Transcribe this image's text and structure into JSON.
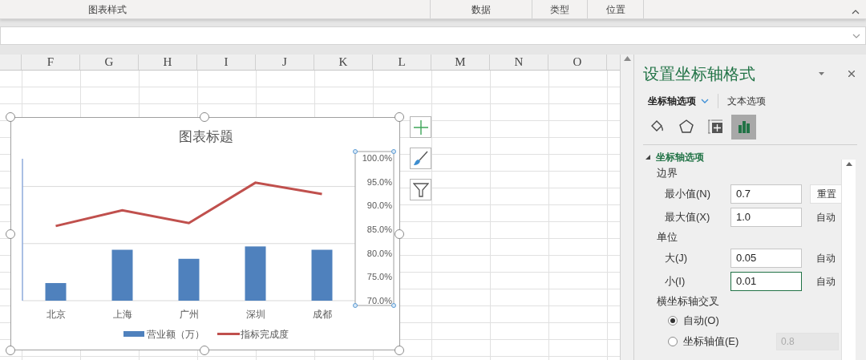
{
  "ribbon": {
    "groups": [
      "图表样式",
      "数据",
      "类型",
      "位置"
    ]
  },
  "columns": [
    "F",
    "G",
    "H",
    "I",
    "J",
    "K",
    "L",
    "M",
    "N",
    "O"
  ],
  "chart": {
    "chart_data": {
      "type": "bar",
      "title": "图表标题",
      "categories": [
        "北京",
        "上海",
        "广州",
        "深圳",
        "成都"
      ],
      "series": [
        {
          "name": "营业额（万）",
          "color": "#4f81bd",
          "values": [
            0.737,
            0.807,
            0.788,
            0.814,
            0.807
          ]
        },
        {
          "name": "指标完成度",
          "color": "#c0504d",
          "type": "line",
          "values": [
            0.857,
            0.89,
            0.863,
            0.948,
            0.924
          ]
        }
      ],
      "ylim": [
        0.7,
        1.0
      ],
      "legend": true,
      "ref_lines": [
        {
          "axis": "y",
          "value": 0.94
        },
        {
          "axis": "y",
          "value": 0.82
        }
      ],
      "yticks": [
        {
          "value": 1.0,
          "label": "100.0%"
        },
        {
          "value": 0.95,
          "label": "95.0%"
        },
        {
          "value": 0.9,
          "label": "90.0%"
        },
        {
          "value": 0.85,
          "label": "85.0%"
        },
        {
          "value": 0.8,
          "label": "80.0%"
        },
        {
          "value": 0.75,
          "label": "75.0%"
        },
        {
          "value": 0.7,
          "label": "70.0%"
        }
      ]
    }
  },
  "panel": {
    "title": "设置坐标轴格式",
    "tabs": [
      {
        "label": "坐标轴选项",
        "selected": true
      },
      {
        "label": "文本选项",
        "selected": false
      }
    ],
    "icon_tabs": [
      {
        "kind": "fill",
        "selected": false
      },
      {
        "kind": "effects",
        "selected": false
      },
      {
        "kind": "size",
        "selected": false
      },
      {
        "kind": "axis",
        "selected": true
      }
    ],
    "section": {
      "title": "坐标轴选项",
      "expanded": true
    },
    "rows": [
      {
        "kind": "heading",
        "label": "边界"
      },
      {
        "kind": "field",
        "label": "最小值(N)",
        "value": "0.7",
        "button": "重置"
      },
      {
        "kind": "field",
        "label": "最大值(X)",
        "value": "1.0",
        "note": "自动"
      },
      {
        "kind": "heading",
        "label": "单位"
      },
      {
        "kind": "field",
        "label": "大(J)",
        "value": "0.05",
        "note": "自动"
      },
      {
        "kind": "field",
        "label": "小(I)",
        "value": "0.01",
        "note": "自动",
        "focused": true
      },
      {
        "kind": "heading",
        "label": "横坐标轴交叉"
      },
      {
        "kind": "radio",
        "label": "自动(O)",
        "selected": true
      },
      {
        "kind": "radio",
        "label": "坐标轴值(E)",
        "selected": false,
        "value": "0.8",
        "disabled": true
      }
    ]
  }
}
